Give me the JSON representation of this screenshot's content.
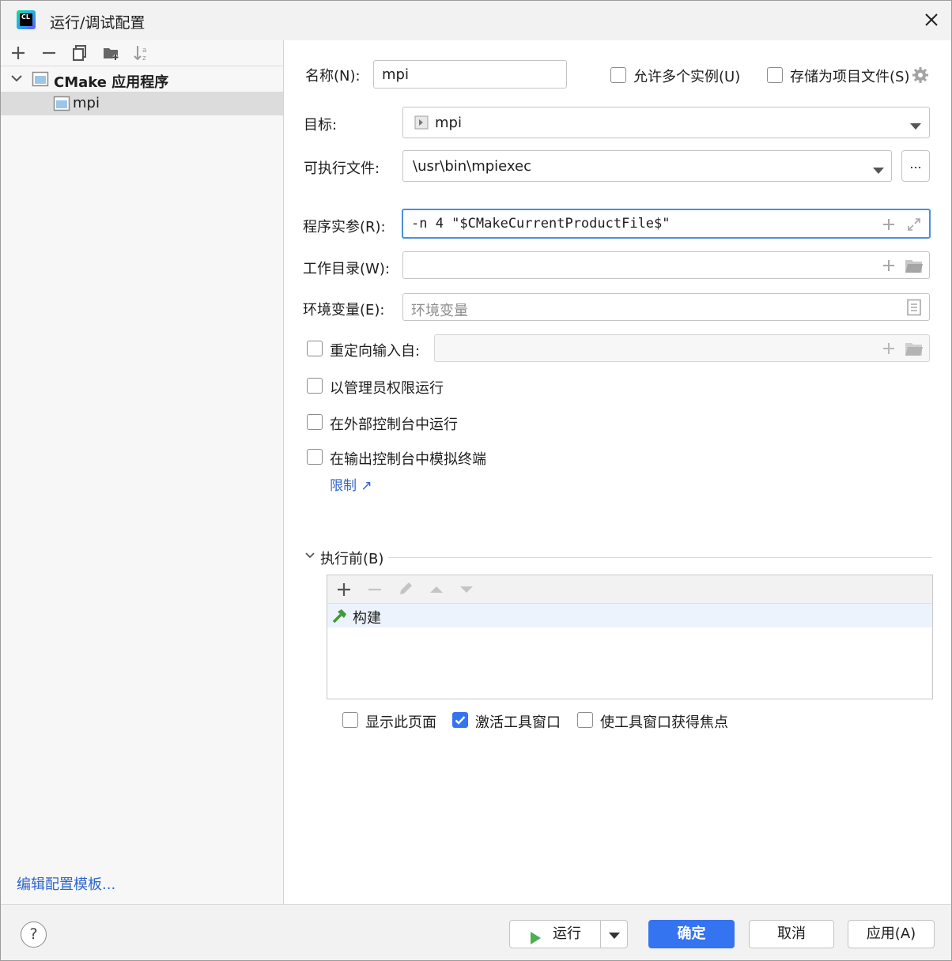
{
  "window": {
    "title": "运行/调试配置",
    "app_logo_text": "CL"
  },
  "left_panel": {
    "tree": {
      "group_label": "CMake 应用程序",
      "item_label": "mpi"
    },
    "edit_templates_link": "编辑配置模板..."
  },
  "form": {
    "name_label": "名称(N):",
    "name_value": "mpi",
    "allow_multiple_label": "允许多个实例(U)",
    "store_as_project_label": "存储为项目文件(S)",
    "target_label": "目标:",
    "target_value": "mpi",
    "executable_label": "可执行文件:",
    "executable_value": "\\usr\\bin\\mpiexec",
    "browse_label": "...",
    "program_args_label": "程序实参(R):",
    "program_args_value": "-n 4 \"$CMakeCurrentProductFile$\"",
    "working_dir_label": "工作目录(W):",
    "working_dir_value": "",
    "env_vars_label": "环境变量(E):",
    "env_vars_placeholder": "环境变量",
    "redirect_input_label": "重定向输入自:",
    "run_as_admin_label": "以管理员权限运行",
    "run_external_console_label": "在外部控制台中运行",
    "emulate_terminal_label": "在输出控制台中模拟终端",
    "limits_link": "限制 ↗"
  },
  "before_launch": {
    "header": "执行前(B)",
    "task_label": "构建"
  },
  "options": {
    "show_page_label": "显示此页面",
    "show_page_checked": false,
    "activate_tool_window_label": "激活工具窗口",
    "activate_tool_window_checked": true,
    "focus_tool_window_label": "使工具窗口获得焦点",
    "focus_tool_window_checked": false
  },
  "footer": {
    "help_label": "?",
    "run_label": "运行",
    "ok_label": "确定",
    "cancel_label": "取消",
    "apply_label": "应用(A)"
  },
  "colors": {
    "accent": "#3574f0",
    "link": "#2f65ca",
    "run_green": "#4caf50"
  }
}
